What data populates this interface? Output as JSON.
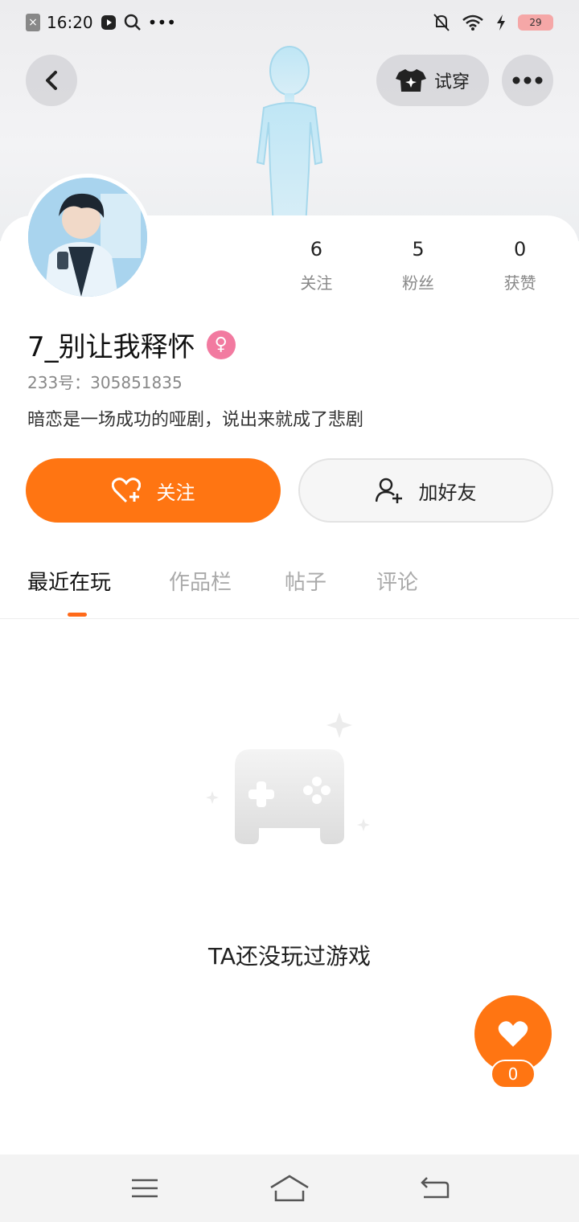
{
  "status_bar": {
    "time": "16:20",
    "battery_level": "29",
    "icons": [
      "notification-x-icon",
      "play-icon",
      "search-icon",
      "more-dots-icon",
      "bell-off-icon",
      "wifi-icon",
      "charging-icon",
      "battery-icon"
    ]
  },
  "header": {
    "try_on_label": "试穿"
  },
  "profile": {
    "stats": [
      {
        "value": "6",
        "label": "关注"
      },
      {
        "value": "5",
        "label": "粉丝"
      },
      {
        "value": "0",
        "label": "获赞"
      }
    ],
    "username": "7_别让我释怀",
    "gender": "female",
    "uid_line": "233号：305851835",
    "bio": "暗恋是一场成功的哑剧，说出来就成了悲剧"
  },
  "actions": {
    "follow_label": "关注",
    "add_friend_label": "加好友"
  },
  "tabs": [
    {
      "label": "最近在玩",
      "active": true
    },
    {
      "label": "作品栏",
      "active": false
    },
    {
      "label": "帖子",
      "active": false
    },
    {
      "label": "评论",
      "active": false
    }
  ],
  "empty_state": {
    "message": "TA还没玩过游戏"
  },
  "like": {
    "count": "0"
  },
  "colors": {
    "accent": "#ff7512",
    "gender_badge": "#f27aa0"
  }
}
